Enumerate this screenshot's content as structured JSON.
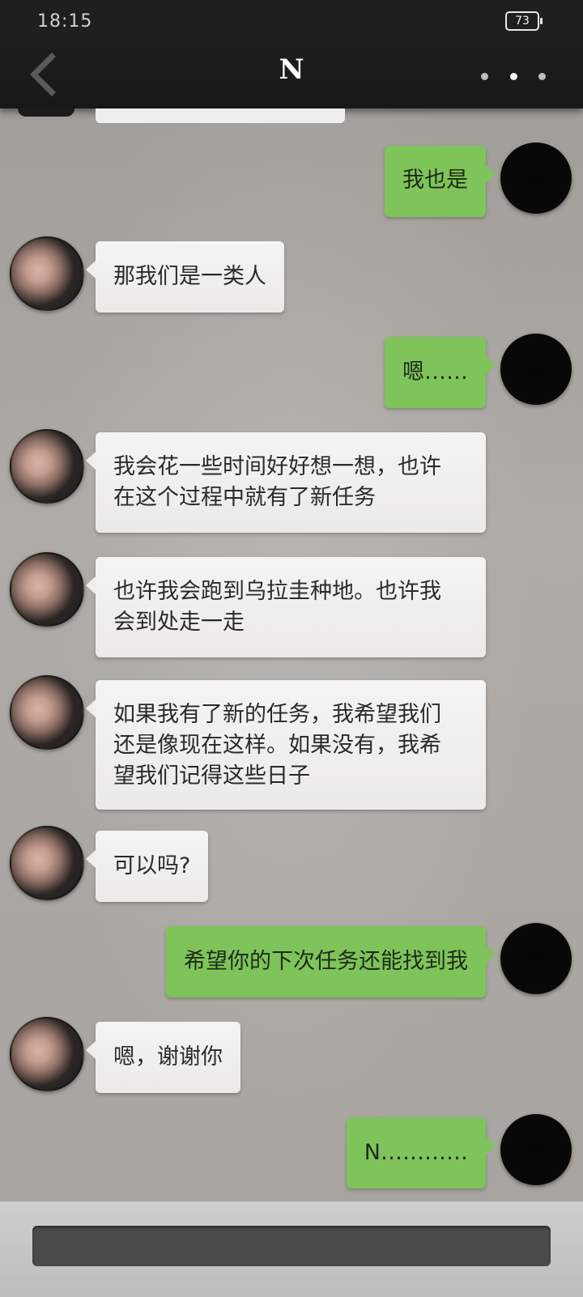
{
  "status": {
    "time": "18:15",
    "battery": "73"
  },
  "header": {
    "title": "N"
  },
  "messages": [
    {
      "side": "out",
      "text": "我也是"
    },
    {
      "side": "in",
      "text": "那我们是一类人"
    },
    {
      "side": "out",
      "text": "嗯……"
    },
    {
      "side": "in",
      "lines": [
        "我会花一些时间好好想一想，也许",
        "在这个过程中就有了新任务"
      ]
    },
    {
      "side": "in",
      "lines": [
        "也许我会跑到乌拉圭种地。也许我",
        "会到处走一走"
      ]
    },
    {
      "side": "in",
      "lines": [
        "如果我有了新的任务，我希望我们",
        "还是像现在这样。如果没有，我希",
        "望我们记得这些日子"
      ]
    },
    {
      "side": "in",
      "text": "可以吗?"
    },
    {
      "side": "out",
      "text": "希望你的下次任务还能找到我"
    },
    {
      "side": "in",
      "text": "嗯，谢谢你"
    },
    {
      "side": "out",
      "text": "N…………"
    }
  ],
  "colors": {
    "outgoing_bubble": "#7ec45a",
    "incoming_bubble": "#efeeeb",
    "titlebar": "#1b1b1b"
  },
  "icons": {
    "back": "chevron-left-icon",
    "more": "more-dots-icon"
  }
}
